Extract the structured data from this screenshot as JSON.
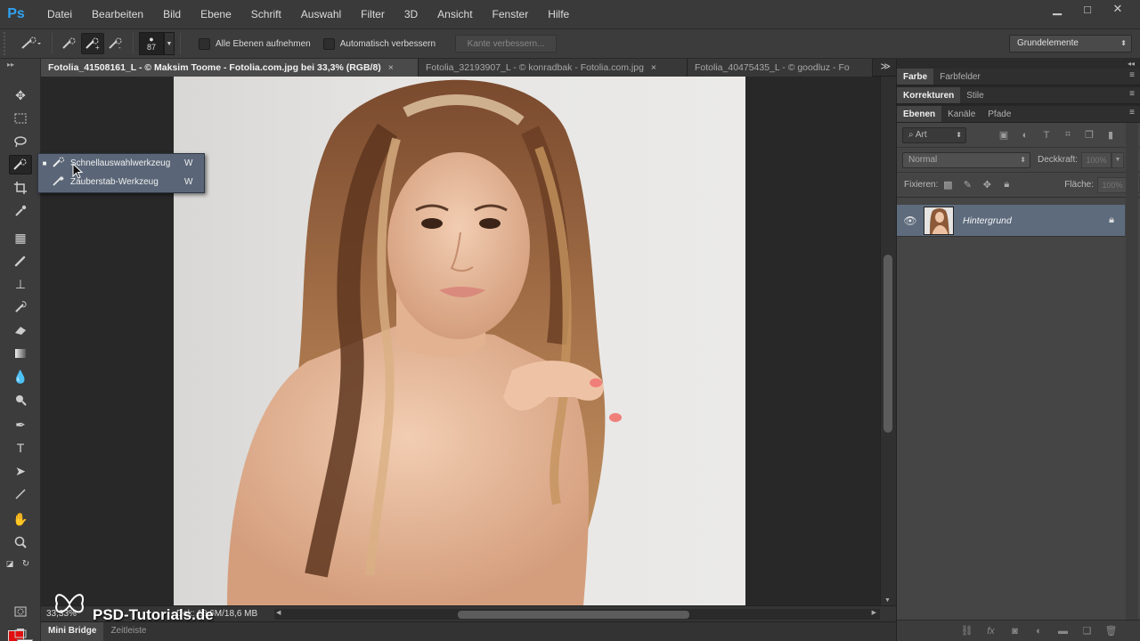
{
  "app": {
    "logo": "Ps",
    "menu": [
      "Datei",
      "Bearbeiten",
      "Bild",
      "Ebene",
      "Schrift",
      "Auswahl",
      "Filter",
      "3D",
      "Ansicht",
      "Fenster",
      "Hilfe"
    ],
    "window_buttons": {
      "minimize": "▁",
      "maximize": "□",
      "close": "✕"
    }
  },
  "options": {
    "brush_size": "87",
    "sample_all_layers": "Alle Ebenen aufnehmen",
    "auto_enhance": "Automatisch verbessern",
    "refine_edge": "Kante verbessern...",
    "workspace": "Grundelemente"
  },
  "tool_flyout": {
    "items": [
      {
        "label": "Schnellauswahlwerkzeug",
        "shortcut": "W",
        "selected": true,
        "icon": "quick-selection-icon"
      },
      {
        "label": "Zauberstab-Werkzeug",
        "shortcut": "W",
        "selected": false,
        "icon": "magic-wand-icon"
      }
    ]
  },
  "document": {
    "tabs": [
      {
        "label": "Fotolia_41508161_L - © Maksim Toome - Fotolia.com.jpg bei 33,3% (RGB/8)",
        "active": true,
        "close": "×"
      },
      {
        "label": "Fotolia_32193907_L - © konradbak - Fotolia.com.jpg",
        "active": false,
        "close": "×"
      },
      {
        "label": "Fotolia_40475435_L - © goodluz - Fo",
        "active": false
      }
    ],
    "zoom": "33,33%",
    "doc_info": "Dok: 18,6M/18,6 MB",
    "watermark": "PSD-Tutorials.de"
  },
  "bottom_tabs": [
    "Mini Bridge",
    "Zeitleiste"
  ],
  "panels": {
    "group1": [
      "Farbe",
      "Farbfelder"
    ],
    "group2": [
      "Korrekturen",
      "Stile"
    ],
    "group3": [
      "Ebenen",
      "Kanäle",
      "Pfade"
    ],
    "layers": {
      "filter_kind": "Art",
      "blend_mode": "Normal",
      "opacity_label": "Deckkraft:",
      "opacity_value": "100%",
      "lock_label": "Fixieren:",
      "fill_label": "Fläche:",
      "fill_value": "100%",
      "layer_name": "Hintergrund"
    }
  },
  "colors": {
    "foreground": "#e10f0f",
    "background": "#ffffff",
    "selection": "#5d6b7d",
    "accent": "#2fa3f3"
  }
}
